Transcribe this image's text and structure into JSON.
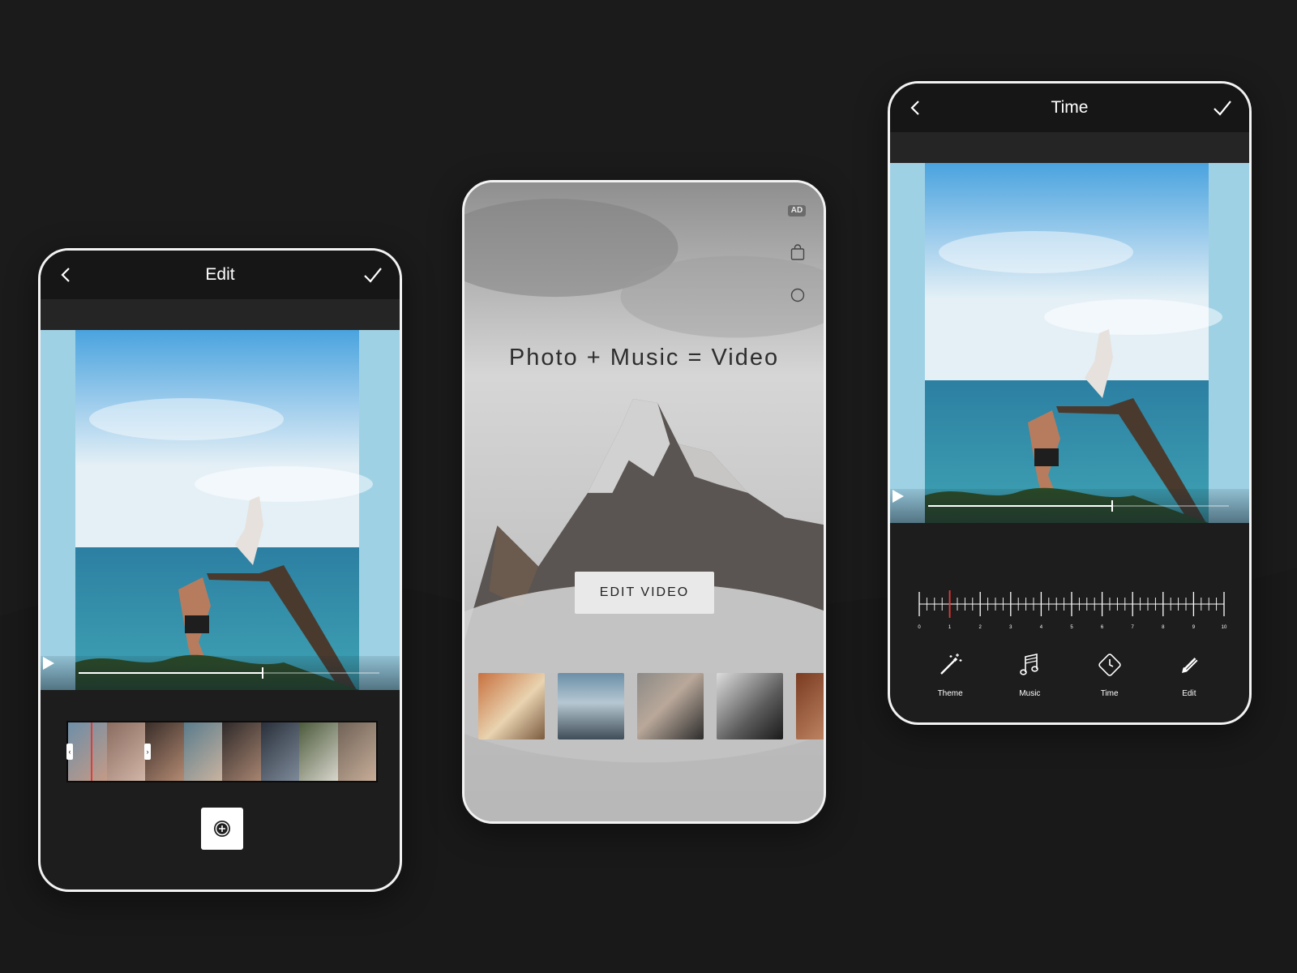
{
  "screens": {
    "edit": {
      "title": "Edit",
      "playback_progress": 0.61,
      "add_button_icon": "plus-circle-icon"
    },
    "home": {
      "ad_badge": "AD",
      "tagline": "Photo + Music = Video",
      "edit_video_label": "EDIT VIDEO",
      "icons": [
        "shopping-bag-icon",
        "circle-icon"
      ]
    },
    "time": {
      "title": "Time",
      "playback_progress": 0.61,
      "ruler_ticks": [
        "0",
        "1",
        "2",
        "3",
        "4",
        "5",
        "6",
        "7",
        "8",
        "9",
        "10"
      ],
      "ruler_marker_value": 1,
      "toolbar": [
        {
          "label": "Theme",
          "icon": "magic-wand-icon"
        },
        {
          "label": "Music",
          "icon": "music-note-icon"
        },
        {
          "label": "Time",
          "icon": "clock-icon"
        },
        {
          "label": "Edit",
          "icon": "pencil-icon"
        }
      ]
    }
  },
  "colors": {
    "background": "#1b1b1b",
    "phone_border": "#f2f2f2",
    "marker_red": "#e53935"
  }
}
